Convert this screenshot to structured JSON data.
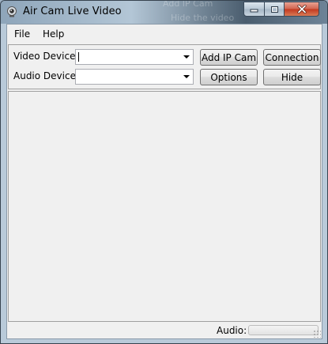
{
  "window": {
    "title": "Air Cam Live Video",
    "background_ghost": [
      "Add IP Cam",
      "Hide the video"
    ]
  },
  "menu": {
    "items": [
      "File",
      "Help"
    ]
  },
  "controls": {
    "video_device_label": "Video Device:",
    "video_device_value": "",
    "audio_device_label": "Audio Device:",
    "audio_device_value": "",
    "add_ip_cam_label": "Add IP Cam",
    "connection_label": "Connection",
    "options_label": "Options",
    "hide_label": "Hide"
  },
  "status": {
    "audio_label": "Audio:",
    "audio_level": 0
  },
  "colors": {
    "client_bg": "#f0f0f0",
    "close_button": "#c2381f",
    "audio_meter_fill": "#35c535"
  },
  "icons": {
    "app": "webcam-icon",
    "minimize": "minimize-icon",
    "maximize": "maximize-icon",
    "close": "close-icon"
  }
}
